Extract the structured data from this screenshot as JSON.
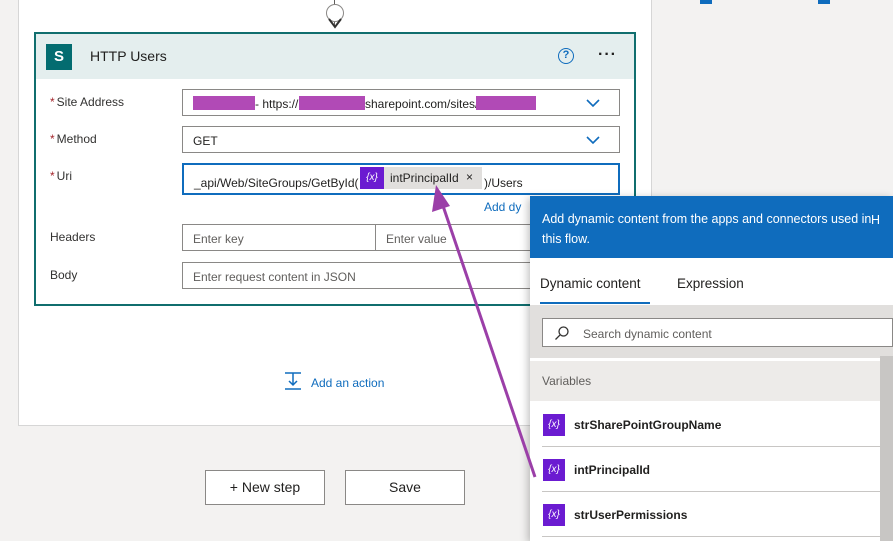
{
  "card": {
    "title": "HTTP Users",
    "icon_letter": "S",
    "help_glyph": "?",
    "more_glyph": "···"
  },
  "fields": {
    "site_address": {
      "label": "Site Address",
      "value_mid": "- https://",
      "value_domain": "sharepoint.com/sites/"
    },
    "method": {
      "label": "Method",
      "value": "GET"
    },
    "uri": {
      "label": "Uri",
      "prefix": "_api/Web/SiteGroups/GetById(",
      "token": "intPrincipalId",
      "token_close": "×",
      "suffix": ")/Users",
      "token_icon": "{x}"
    },
    "add_dynamic_link": "Add dy",
    "headers": {
      "label": "Headers",
      "key_placeholder": "Enter key",
      "value_placeholder": "Enter value"
    },
    "body": {
      "label": "Body",
      "placeholder": "Enter request content in JSON"
    },
    "required_mark": "*"
  },
  "add_action": {
    "label": "Add an action"
  },
  "buttons": {
    "new_step": "+ New step",
    "save": "Save"
  },
  "flyout": {
    "header_text": "Add dynamic content from the apps and connectors used in this flow.",
    "header_extra": "H",
    "tabs": [
      "Dynamic content",
      "Expression"
    ],
    "search_placeholder": "Search dynamic content",
    "section": "Variables",
    "items": [
      {
        "icon": "{x}",
        "label": "strSharePointGroupName"
      },
      {
        "icon": "{x}",
        "label": "intPrincipalId"
      },
      {
        "icon": "{x}",
        "label": "strUserPermissions"
      }
    ]
  },
  "colors": {
    "accent": "#0f6cbd",
    "card_border": "#106e6e",
    "variable_purple": "#6b1bd1",
    "redaction": "#b14ab6",
    "annotation_arrow": "#9b3fa8"
  }
}
